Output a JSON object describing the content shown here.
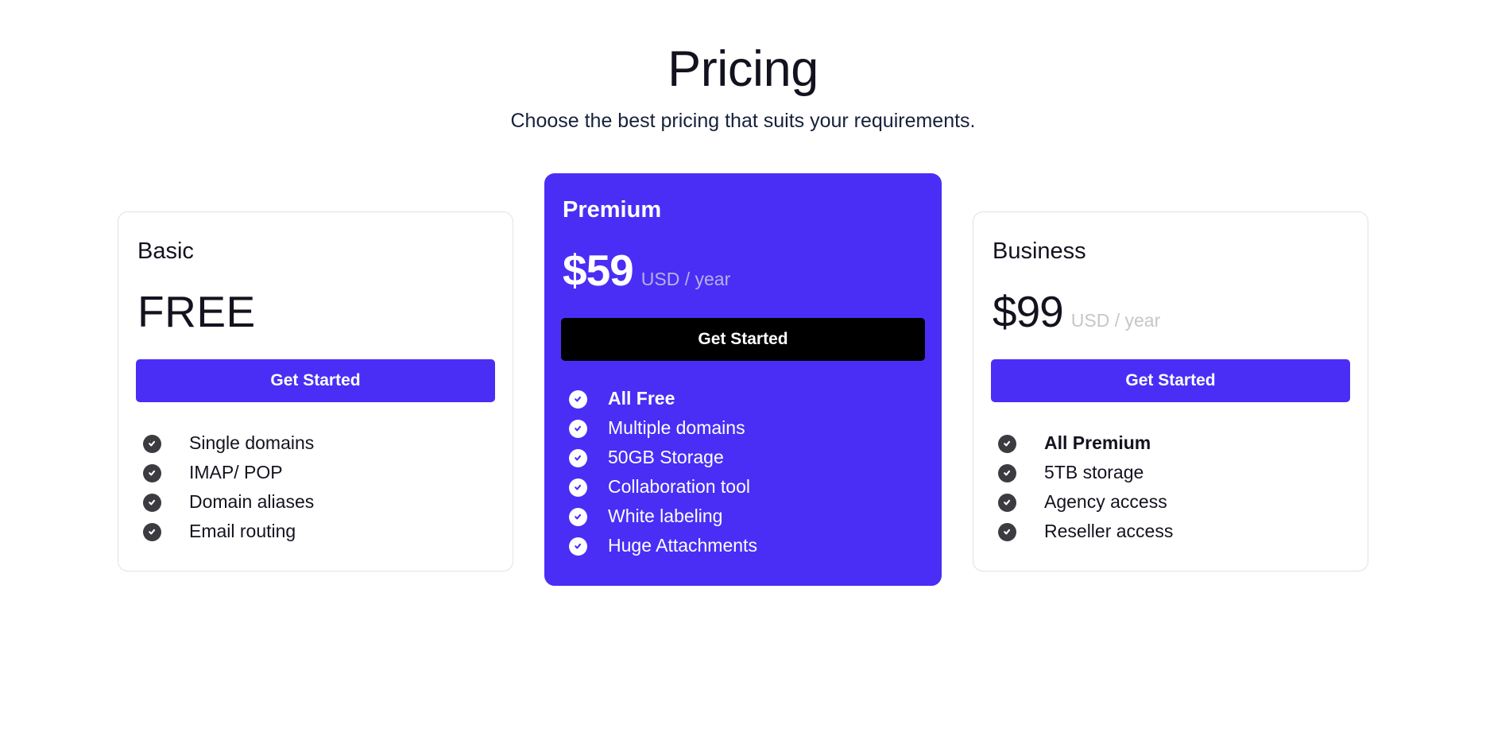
{
  "header": {
    "title": "Pricing",
    "subtitle": "Choose the best pricing that suits your requirements."
  },
  "theme": {
    "accent": "#4a2ef5",
    "text_dark": "#13131f",
    "muted": "#c6c6cb",
    "card_border": "#e2e2e6",
    "featured_button": "#000000",
    "check_dark": "#3c3c40"
  },
  "plans": [
    {
      "name": "Basic",
      "price": "FREE",
      "period": "",
      "featured": false,
      "cta": "Get Started",
      "features": [
        {
          "label": "Single domains",
          "bold": false
        },
        {
          "label": "IMAP/ POP",
          "bold": false
        },
        {
          "label": "Domain aliases",
          "bold": false
        },
        {
          "label": "Email routing",
          "bold": false
        }
      ]
    },
    {
      "name": "Premium",
      "price": "$59",
      "period": "USD / year",
      "featured": true,
      "cta": "Get Started",
      "features": [
        {
          "label": "All Free",
          "bold": true
        },
        {
          "label": "Multiple domains",
          "bold": false
        },
        {
          "label": "50GB Storage",
          "bold": false
        },
        {
          "label": "Collaboration tool",
          "bold": false
        },
        {
          "label": "White labeling",
          "bold": false
        },
        {
          "label": "Huge Attachments",
          "bold": false
        }
      ]
    },
    {
      "name": "Business",
      "price": "$99",
      "period": "USD / year",
      "featured": false,
      "cta": "Get Started",
      "features": [
        {
          "label": "All Premium",
          "bold": true
        },
        {
          "label": "5TB storage",
          "bold": false
        },
        {
          "label": "Agency access",
          "bold": false
        },
        {
          "label": "Reseller access",
          "bold": false
        }
      ]
    }
  ]
}
